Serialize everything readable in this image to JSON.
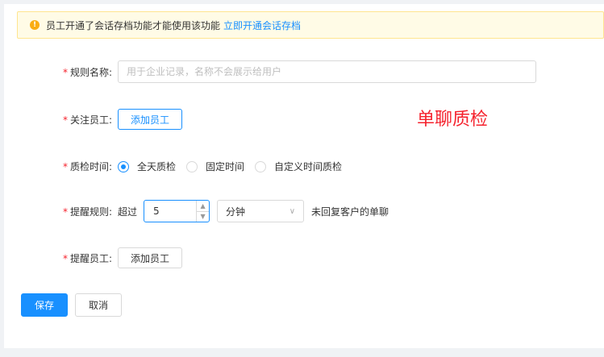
{
  "alert": {
    "text": "员工开通了会话存档功能才能使用该功能",
    "link": "立即开通会话存档"
  },
  "watermark": "单聊质检",
  "form": {
    "rule_name": {
      "label": "规则名称:",
      "placeholder": "用于企业记录，名称不会展示给用户",
      "value": ""
    },
    "staff": {
      "label": "关注员工:",
      "button": "添加员工"
    },
    "time": {
      "label": "质检时间:",
      "options": [
        "全天质检",
        "固定时间",
        "自定义时间质检"
      ],
      "selected": "全天质检"
    },
    "remind": {
      "label": "提醒规则:",
      "prefix": "超过",
      "value": "5",
      "unit": "分钟",
      "suffix": "未回复客户的单聊"
    },
    "remind_staff": {
      "label": "提醒员工:",
      "button": "添加员工"
    }
  },
  "actions": {
    "save": "保存",
    "cancel": "取消"
  },
  "colors": {
    "primary": "#1890ff",
    "required": "#f5222d",
    "alert_bg": "#fffbe6",
    "warn": "#faad14"
  }
}
